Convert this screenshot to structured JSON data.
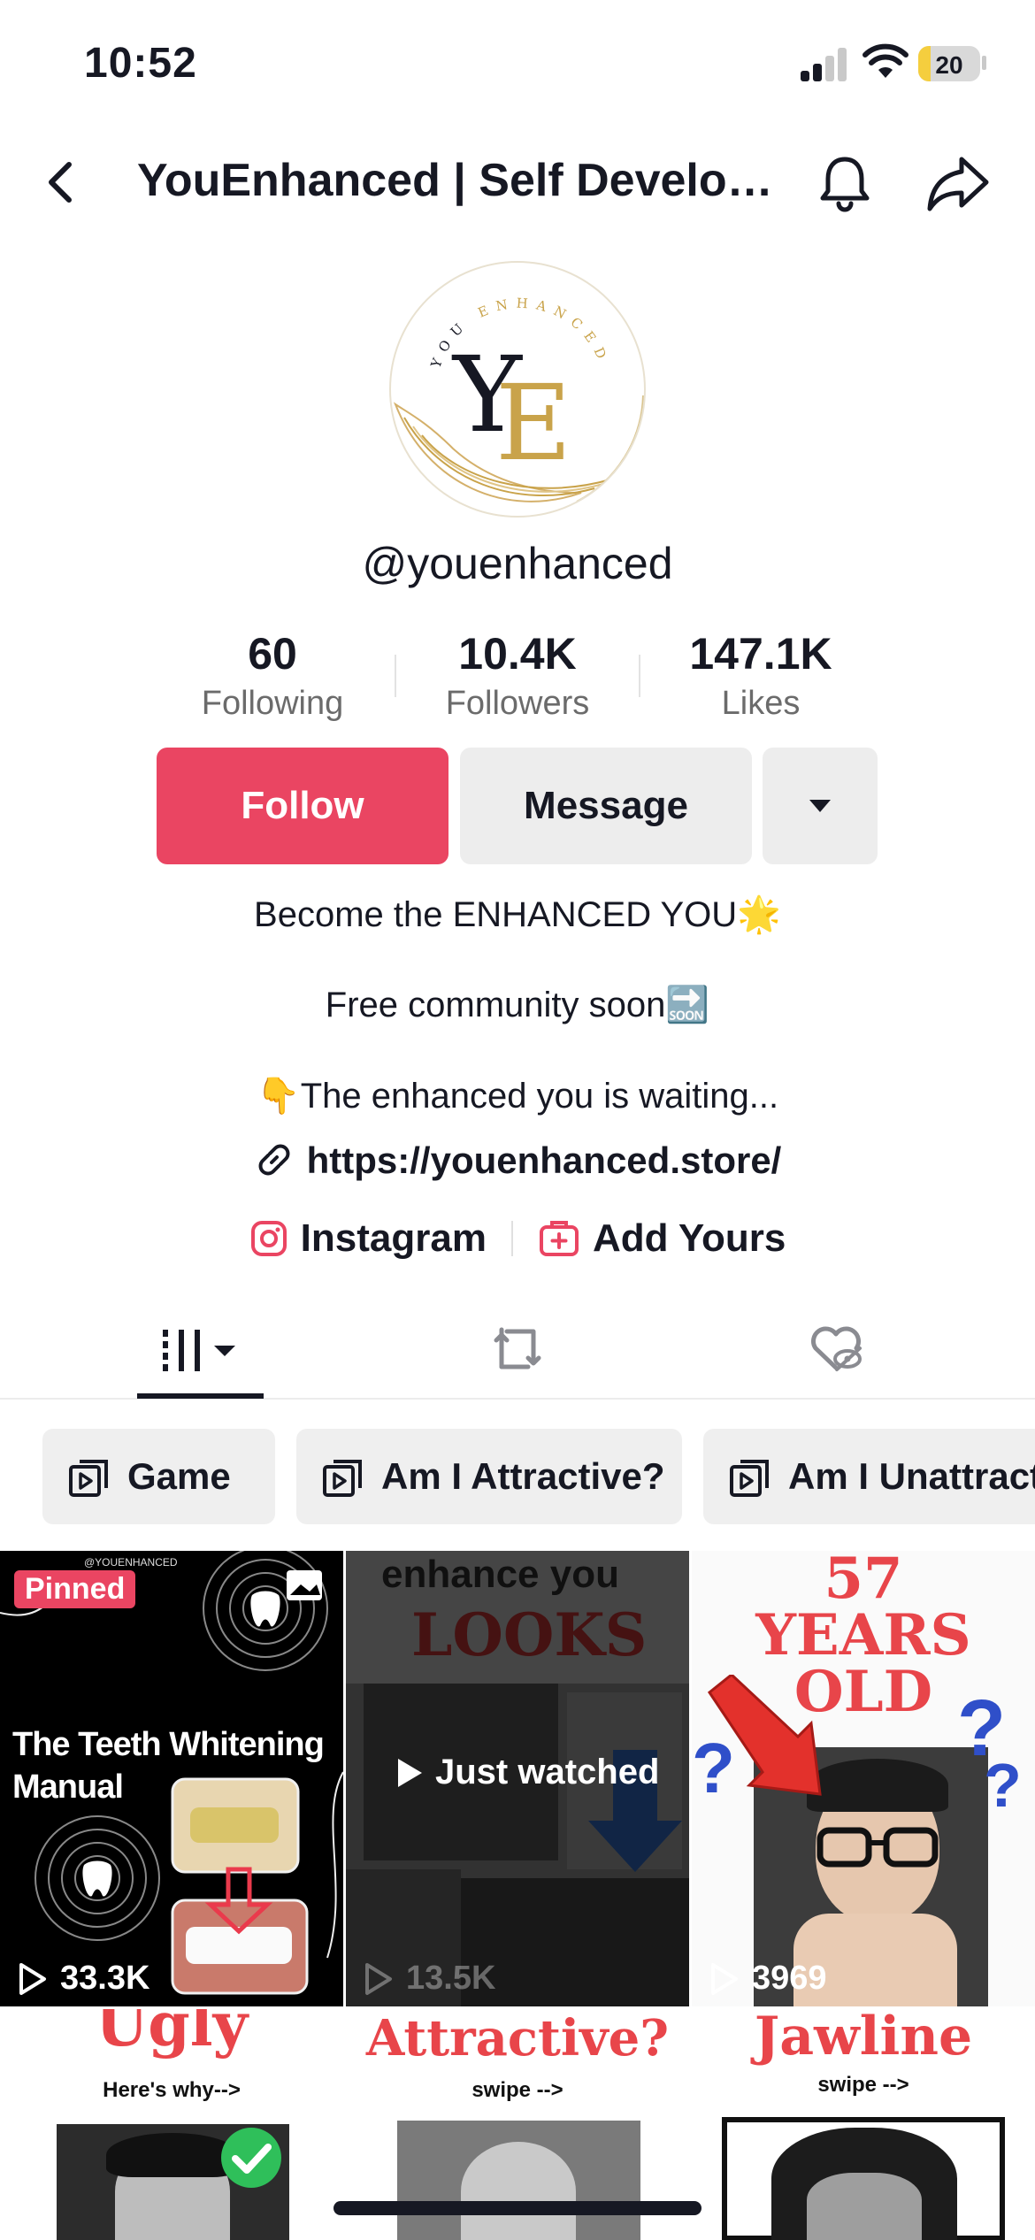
{
  "status_bar": {
    "time": "10:52",
    "battery": "20",
    "battery_level": 0.2
  },
  "header": {
    "title": "YouEnhanced | Self Develop...",
    "back_icon": "chevron-left-icon",
    "bell_icon": "bell-icon",
    "share_icon": "share-arrow-icon"
  },
  "avatar": {
    "logo_letters": "YE",
    "ring_text": "YOU ENHANCED"
  },
  "profile": {
    "handle": "@youenhanced",
    "stats": [
      {
        "value": "60",
        "label": "Following"
      },
      {
        "value": "10.4K",
        "label": "Followers"
      },
      {
        "value": "147.1K",
        "label": "Likes"
      }
    ],
    "buttons": {
      "follow": "Follow",
      "message": "Message"
    },
    "bio": {
      "line1": "Become the ENHANCED YOU🌟",
      "line2": "Free community soon🔜",
      "line3": "👇The enhanced you is waiting...",
      "link": "https://youenhanced.store/"
    },
    "social": {
      "instagram": "Instagram",
      "add_yours": "Add Yours"
    }
  },
  "tabs": [
    {
      "name": "videos",
      "icon": "grid-bars-icon",
      "active": true
    },
    {
      "name": "reposts",
      "icon": "repost-icon",
      "active": false
    },
    {
      "name": "liked",
      "icon": "heart-hidden-icon",
      "active": false
    }
  ],
  "playlists": [
    "Game",
    "Am I Attractive?",
    "Am I Unattractive"
  ],
  "videos": [
    {
      "pinned_label": "Pinned",
      "watermark": "@YOUENHANCED",
      "title_lines": [
        "The Teeth Whitening",
        "Manual"
      ],
      "views": "33.3K"
    },
    {
      "overlay": "Just watched",
      "top_text": "enhance you",
      "headline": "LOOKS",
      "views": "13.5K"
    },
    {
      "headline_lines": [
        "57",
        "YEARS",
        "OLD"
      ],
      "views": "3969"
    },
    {
      "headline": "Ugly",
      "subtext": "Here's why-->"
    },
    {
      "headline": "Attractive?",
      "subtext": "swipe -->"
    },
    {
      "headline": "Jawline",
      "subtext": "swipe -->"
    }
  ],
  "colors": {
    "accent": "#ea4562",
    "text": "#161823",
    "muted": "#6b6b6b",
    "gold": "#c9a34a"
  }
}
